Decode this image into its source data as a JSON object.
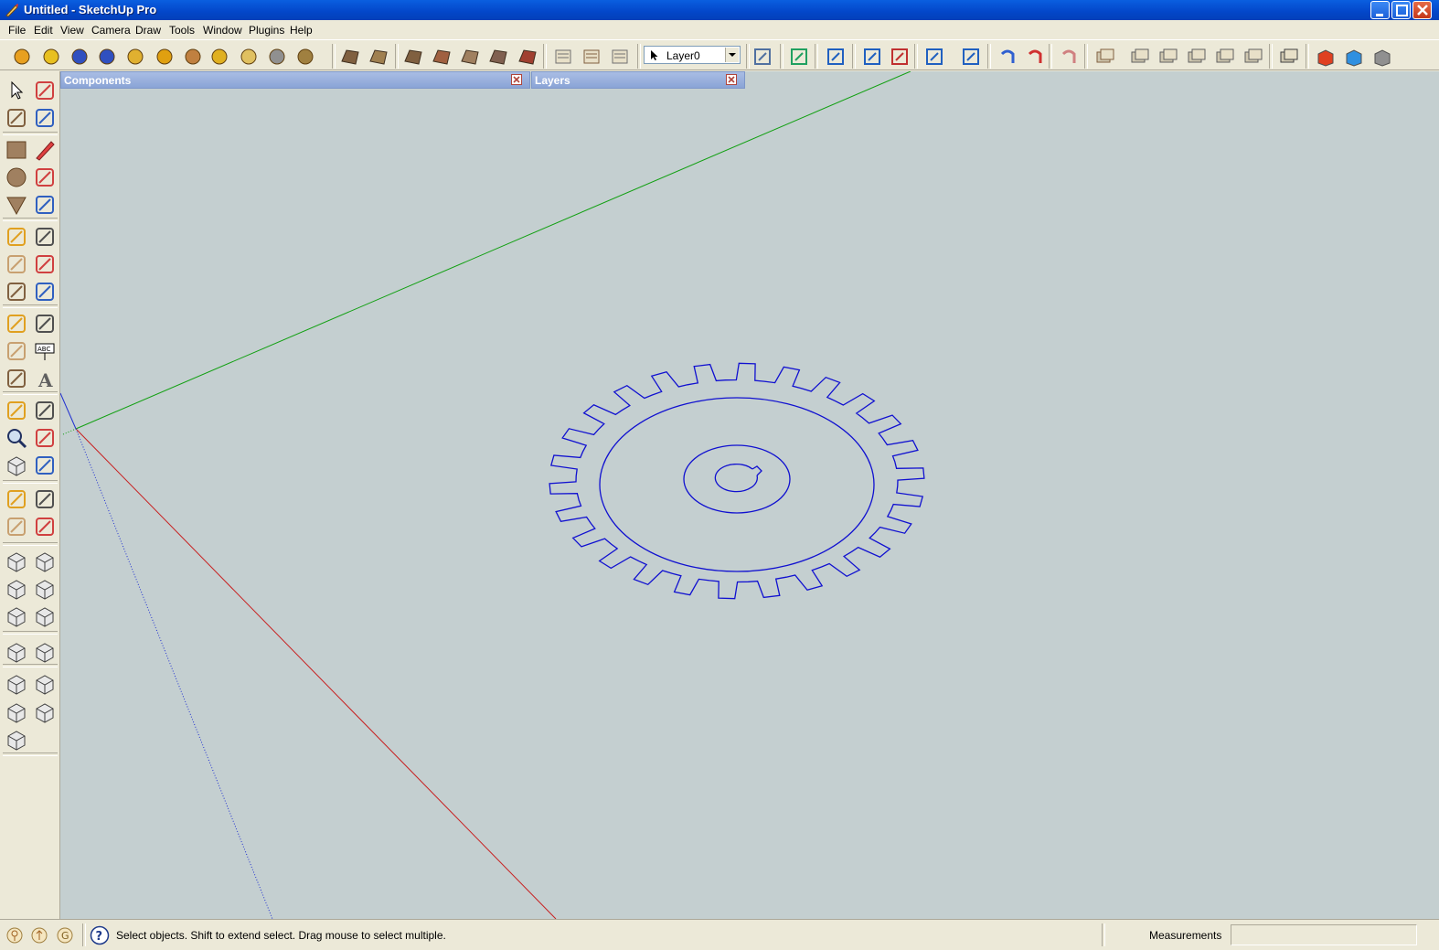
{
  "window": {
    "title": "Untitled - SketchUp Pro"
  },
  "menubar": {
    "items": [
      "File",
      "Edit",
      "View",
      "Camera",
      "Draw",
      "Tools",
      "Window",
      "Plugins",
      "Help"
    ]
  },
  "toolbar": {
    "layer_value": "Layer0",
    "icons": [
      "m-icon",
      "tag-icon",
      "r-icon",
      "help-icon",
      "label-icon",
      "sphere-icon",
      "pin-icon",
      "arrow-icon",
      "cloud-icon",
      "circle-icon",
      "cross-icon",
      "sandbox-from-contours-icon",
      "sandbox-from-scratch-icon",
      "smoove-icon",
      "stamp-icon",
      "drape-icon",
      "add-detail-icon",
      "flip-edge-icon",
      "select-hand-icon",
      "layer-manager-icon",
      "layer-props-icon",
      "layer-info-icon",
      "face-icon",
      "column-icon",
      "push-up-icon",
      "push-down-icon",
      "scale-icon",
      "flip-icon",
      "undo-icon",
      "redo-icon",
      "paint-icon",
      "section-icon",
      "group-icon",
      "ungroup-icon",
      "copy-icon",
      "move-icon",
      "stack-icon",
      "solid-icon",
      "component-red-icon",
      "component-blue-icon",
      "component-grey-icon"
    ]
  },
  "panels": {
    "components_title": "Components",
    "layers_title": "Layers"
  },
  "status": {
    "hint": "Select objects. Shift to extend select. Drag mouse to select multiple.",
    "measurements_label": "Measurements",
    "measurements_value": ""
  },
  "colors": {
    "viewport_bg": "#c4cfd0",
    "gear_line": "#1010d0",
    "axis_green": "#12a012",
    "axis_red": "#c81e1e",
    "axis_blue": "#2030d0",
    "titlebar": "#0346c9"
  }
}
